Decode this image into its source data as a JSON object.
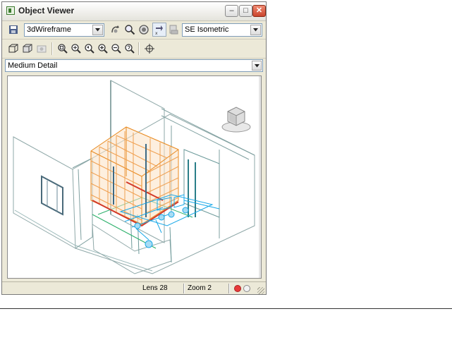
{
  "window": {
    "title": "Object Viewer"
  },
  "toolbar": {
    "visual_style": "3dWireframe",
    "view": "SE Isometric",
    "icons": [
      "save-icon",
      "orbit-icon",
      "zoom-icon",
      "camera-icon",
      "swap-icon",
      "export-icon",
      "wireframe-cube-icon",
      "solid-cube-icon",
      "render-icon",
      "zoom-extents-icon",
      "zoom-window-icon",
      "zoom-previous-icon",
      "zoom-in-icon",
      "zoom-out-icon",
      "zoom-realtime-icon",
      "pan-target-icon"
    ]
  },
  "detail": {
    "level": "Medium Detail"
  },
  "status": {
    "lens": "Lens 28",
    "zoom": "Zoom 2"
  },
  "colors": {
    "red_dot": "#e83a3a",
    "brick": "#e8891e",
    "cyan": "#18a8e8",
    "teal": "#5fa7a7",
    "green": "#26b86a"
  }
}
